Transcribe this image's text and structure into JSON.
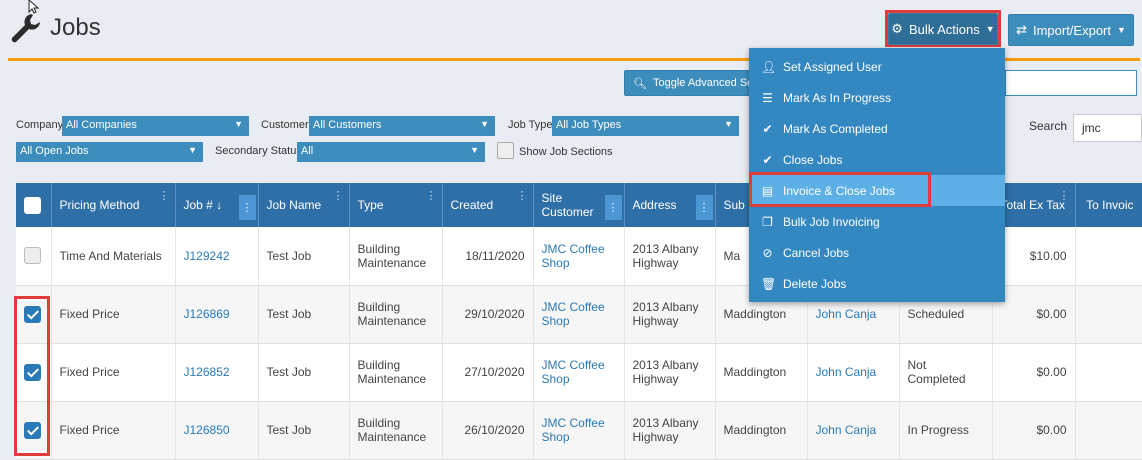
{
  "header": {
    "title": "Jobs",
    "bulk_actions_label": "Bulk Actions",
    "import_export_label": "Import/Export"
  },
  "toggle_advanced_label": "Toggle Advanced Search",
  "filters": {
    "company_label": "Company",
    "company_value": "All Companies",
    "customer_label": "Customer",
    "customer_value": "All Customers",
    "job_type_label": "Job Type",
    "job_type_value": "All Job Types",
    "status_value": "All Open Jobs",
    "secondary_status_label": "Secondary Status",
    "secondary_status_value": "All",
    "show_job_sections_label": "Show Job Sections",
    "search_label": "Search",
    "search_value": "jmc"
  },
  "bulk_menu": {
    "items": [
      {
        "label": "Set Assigned User",
        "icon": "user-icon"
      },
      {
        "label": "Mark As In Progress",
        "icon": "list-icon"
      },
      {
        "label": "Mark As Completed",
        "icon": "check-icon"
      },
      {
        "label": "Close Jobs",
        "icon": "check-icon"
      },
      {
        "label": "Invoice & Close Jobs",
        "icon": "invoice-icon"
      },
      {
        "label": "Bulk Job Invoicing",
        "icon": "copy-icon"
      },
      {
        "label": "Cancel Jobs",
        "icon": "ban-icon"
      },
      {
        "label": "Delete Jobs",
        "icon": "trash-icon"
      }
    ]
  },
  "table": {
    "columns": {
      "pricing_method": "Pricing Method",
      "job_no": "Job #",
      "job_name": "Job Name",
      "type": "Type",
      "created": "Created",
      "site_customer": "Site Customer",
      "address": "Address",
      "suburb": "Sub",
      "total_ex_tax": "Total Ex Tax",
      "total_invoiced": "To Invoic"
    },
    "rows": [
      {
        "checked": false,
        "pricing": "Time And Materials",
        "job_no": "J129242",
        "job_name": "Test Job",
        "type": "Building Maintenance",
        "created": "18/11/2020",
        "customer": "JMC Coffee Shop",
        "address": "2013 Albany Highway",
        "suburb": "Ma",
        "assignee": "",
        "status": "",
        "total": "$10.00"
      },
      {
        "checked": true,
        "pricing": "Fixed Price",
        "job_no": "J126869",
        "job_name": "Test Job",
        "type": "Building Maintenance",
        "created": "29/10/2020",
        "customer": "JMC Coffee Shop",
        "address": "2013 Albany Highway",
        "suburb": "Maddington",
        "assignee": "John Canja",
        "status": "Scheduled",
        "total": "$0.00"
      },
      {
        "checked": true,
        "pricing": "Fixed Price",
        "job_no": "J126852",
        "job_name": "Test Job",
        "type": "Building Maintenance",
        "created": "27/10/2020",
        "customer": "JMC Coffee Shop",
        "address": "2013 Albany Highway",
        "suburb": "Maddington",
        "assignee": "John Canja",
        "status": "Not Completed",
        "total": "$0.00"
      },
      {
        "checked": true,
        "pricing": "Fixed Price",
        "job_no": "J126850",
        "job_name": "Test Job",
        "type": "Building Maintenance",
        "created": "26/10/2020",
        "customer": "JMC Coffee Shop",
        "address": "2013 Albany Highway",
        "suburb": "Maddington",
        "assignee": "John Canja",
        "status": "In Progress",
        "total": "$0.00"
      }
    ]
  },
  "colors": {
    "primary": "#3c8dbc",
    "table_header": "#2f6fa8",
    "accent_line": "#f39c12",
    "highlight": "#e03c3c",
    "menu_active": "#5db0e6"
  }
}
